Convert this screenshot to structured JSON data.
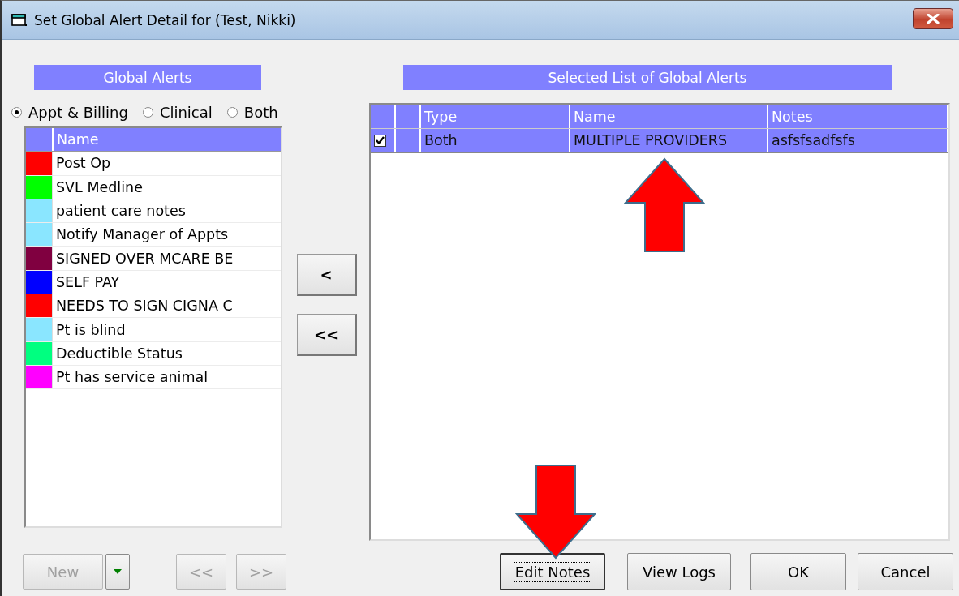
{
  "window": {
    "title": "Set Global Alert Detail for (Test, Nikki)"
  },
  "global_alerts": {
    "heading": "Global Alerts",
    "filters": [
      {
        "label": "Appt & Billing",
        "selected": true
      },
      {
        "label": "Clinical",
        "selected": false
      },
      {
        "label": "Both",
        "selected": false
      }
    ],
    "columns": [
      "Name"
    ],
    "items": [
      {
        "name": "Post Op",
        "color": "#ff0000"
      },
      {
        "name": "SVL Medline",
        "color": "#00ff00"
      },
      {
        "name": "patient care notes",
        "color": "#8ae6ff"
      },
      {
        "name": "Notify Manager of Appts",
        "color": "#8ae6ff"
      },
      {
        "name": "SIGNED OVER MCARE BE",
        "color": "#800040"
      },
      {
        "name": "SELF PAY",
        "color": "#0000ff"
      },
      {
        "name": "NEEDS TO SIGN CIGNA C",
        "color": "#ff0000"
      },
      {
        "name": "Pt is blind",
        "color": "#8ae6ff"
      },
      {
        "name": "Deductible Status",
        "color": "#00ff80"
      },
      {
        "name": "Pt has service animal",
        "color": "#ff00ff"
      }
    ]
  },
  "move_buttons": [
    {
      "label": "<"
    },
    {
      "label": "<<"
    }
  ],
  "selected_alerts": {
    "heading": "Selected List of Global Alerts",
    "columns": [
      "Type",
      "Name",
      "Notes"
    ],
    "rows": [
      {
        "checked": true,
        "selected": true,
        "type": "Both",
        "name": "MULTIPLE PROVIDERS",
        "notes": "asfsfsadfsfs"
      }
    ]
  },
  "left_buttons": [
    {
      "label": "New",
      "kind": "split",
      "disabled": true
    },
    {
      "label": "<<",
      "kind": "plain",
      "disabled": true
    },
    {
      "label": ">>",
      "kind": "plain",
      "disabled": true
    }
  ],
  "dialog_buttons": [
    {
      "label": "Edit Notes",
      "focused": true
    },
    {
      "label": "View Logs",
      "focused": false
    },
    {
      "label": "OK",
      "focused": false
    },
    {
      "label": "Cancel",
      "focused": false
    }
  ]
}
